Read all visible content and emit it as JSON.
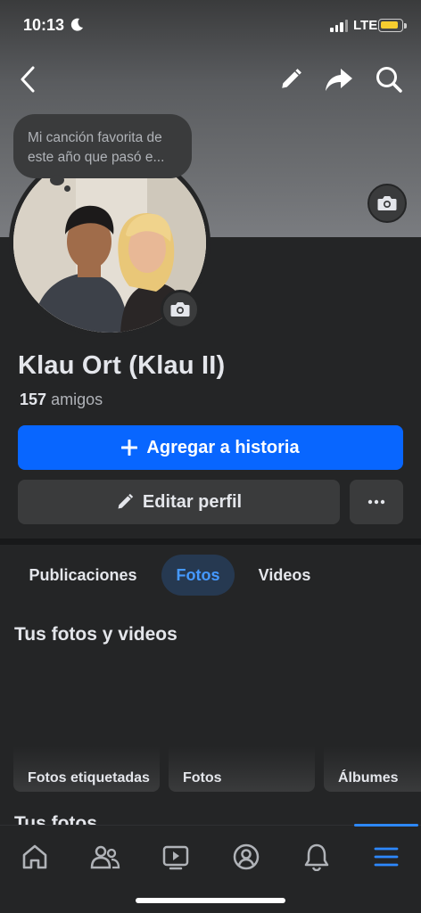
{
  "status_bar": {
    "time": "10:13",
    "network": "LTE"
  },
  "note": {
    "text_line1": "Mi canción favorita de",
    "text_line2": "este año que pasó e..."
  },
  "profile": {
    "name": "Klau Ort (Klau II)",
    "friends_count": "157",
    "friends_label": "amigos"
  },
  "actions": {
    "add_story": "Agregar a historia",
    "edit_profile": "Editar perfil"
  },
  "tabs": [
    {
      "label": "Publicaciones",
      "active": false
    },
    {
      "label": "Fotos",
      "active": true
    },
    {
      "label": "Videos",
      "active": false
    }
  ],
  "section": {
    "title": "Tus fotos y videos",
    "subtitle": "Tus fotos"
  },
  "albums": [
    {
      "label": "Fotos etiquetadas"
    },
    {
      "label": "Fotos"
    },
    {
      "label": "Álbumes"
    }
  ],
  "bottom_nav": [
    {
      "icon": "home-icon"
    },
    {
      "icon": "friends-icon"
    },
    {
      "icon": "video-icon"
    },
    {
      "icon": "profile-icon"
    },
    {
      "icon": "bell-icon"
    },
    {
      "icon": "menu-icon",
      "active": true
    }
  ],
  "colors": {
    "accent": "#0866ff",
    "active_tab_bg": "#263951",
    "active_tab_text": "#4599ff",
    "background": "#242526"
  }
}
